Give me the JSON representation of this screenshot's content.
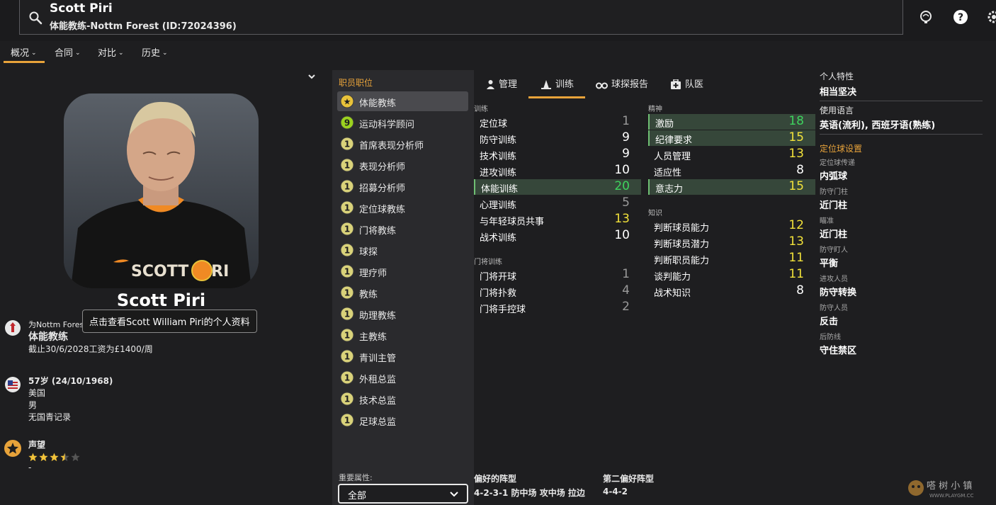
{
  "header": {
    "name": "Scott Piri",
    "subtitle": "体能教练-Nottm Forest (ID:72024396)"
  },
  "nav": [
    {
      "label": "概况"
    },
    {
      "label": "合同"
    },
    {
      "label": "对比"
    },
    {
      "label": "历史"
    }
  ],
  "profile": {
    "display_name": "Scott Piri",
    "tooltip": "点击查看Scott William Piri的个人资料",
    "club_line": "为Nottm Forest",
    "role": "体能教练",
    "contract": "截止30/6/2028工资为£1400/周",
    "age": "57岁 (24/10/1968)",
    "nationality": "美国",
    "gender": "男",
    "youth_record": "无国青记录",
    "reputation_label": "声望",
    "reputation_stars": 3.5,
    "reputation_value": "-"
  },
  "roles": {
    "title": "职员职位",
    "items": [
      {
        "label": "体能教练",
        "badge": "★",
        "badge_color": "#e8c23a",
        "active": true
      },
      {
        "label": "运动科学顾问",
        "badge": "9",
        "badge_color": "#9bd11f",
        "active": false
      },
      {
        "label": "首席表现分析师",
        "badge": "1",
        "badge_color": "#d9d27a",
        "active": false
      },
      {
        "label": "表现分析师",
        "badge": "1",
        "badge_color": "#d9d27a",
        "active": false
      },
      {
        "label": "招募分析师",
        "badge": "1",
        "badge_color": "#d9d27a",
        "active": false
      },
      {
        "label": "定位球教练",
        "badge": "1",
        "badge_color": "#d9d27a",
        "active": false
      },
      {
        "label": "门将教练",
        "badge": "1",
        "badge_color": "#d9d27a",
        "active": false
      },
      {
        "label": "球探",
        "badge": "1",
        "badge_color": "#d9d27a",
        "active": false
      },
      {
        "label": "理疗师",
        "badge": "1",
        "badge_color": "#d9d27a",
        "active": false
      },
      {
        "label": "教练",
        "badge": "1",
        "badge_color": "#d9d27a",
        "active": false
      },
      {
        "label": "助理教练",
        "badge": "1",
        "badge_color": "#d9d27a",
        "active": false
      },
      {
        "label": "主教练",
        "badge": "1",
        "badge_color": "#d9d27a",
        "active": false
      },
      {
        "label": "青训主管",
        "badge": "1",
        "badge_color": "#d9d27a",
        "active": false
      },
      {
        "label": "外租总监",
        "badge": "1",
        "badge_color": "#d9d27a",
        "active": false
      },
      {
        "label": "技术总监",
        "badge": "1",
        "badge_color": "#d9d27a",
        "active": false
      },
      {
        "label": "足球总监",
        "badge": "1",
        "badge_color": "#d9d27a",
        "active": false
      }
    ],
    "key_attr_label": "重要属性:",
    "key_attr_value": "全部"
  },
  "tabs": [
    {
      "label": "管理",
      "icon": "person-icon"
    },
    {
      "label": "训练",
      "icon": "cone-icon"
    },
    {
      "label": "球探报告",
      "icon": "binoculars-icon"
    },
    {
      "label": "队医",
      "icon": "medkit-icon"
    }
  ],
  "attributes": {
    "training_title": "训练",
    "training": [
      {
        "name": "定位球",
        "value": 1,
        "hl": false
      },
      {
        "name": "防守训练",
        "value": 9,
        "hl": false
      },
      {
        "name": "技术训练",
        "value": 9,
        "hl": false
      },
      {
        "name": "进攻训练",
        "value": 10,
        "hl": false
      },
      {
        "name": "体能训练",
        "value": 20,
        "hl": true
      },
      {
        "name": "心理训练",
        "value": 5,
        "hl": false
      },
      {
        "name": "与年轻球员共事",
        "value": 13,
        "hl": false
      },
      {
        "name": "战术训练",
        "value": 10,
        "hl": false
      }
    ],
    "gk_title": "门将训练",
    "gk": [
      {
        "name": "门将开球",
        "value": 1,
        "hl": false
      },
      {
        "name": "门将扑救",
        "value": 4,
        "hl": false
      },
      {
        "name": "门将手控球",
        "value": 2,
        "hl": false
      }
    ],
    "mental_title": "精神",
    "mental": [
      {
        "name": "激励",
        "value": 18,
        "hl": true
      },
      {
        "name": "纪律要求",
        "value": 15,
        "hl": true
      },
      {
        "name": "人员管理",
        "value": 13,
        "hl": false
      },
      {
        "name": "适应性",
        "value": 8,
        "hl": false
      },
      {
        "name": "意志力",
        "value": 15,
        "hl": true
      }
    ],
    "knowledge_title": "知识",
    "knowledge": [
      {
        "name": "判断球员能力",
        "value": 12,
        "hl": false
      },
      {
        "name": "判断球员潜力",
        "value": 13,
        "hl": false
      },
      {
        "name": "判断职员能力",
        "value": 11,
        "hl": false
      },
      {
        "name": "谈判能力",
        "value": 11,
        "hl": false
      },
      {
        "name": "战术知识",
        "value": 8,
        "hl": false
      }
    ]
  },
  "formations": {
    "preferred_label": "偏好的阵型",
    "preferred_value": "4-2-3-1 防中场 攻中场 拉边",
    "second_label": "第二偏好阵型",
    "second_value": "4-4-2"
  },
  "right": {
    "trait_label": "个人特性",
    "trait_value": "相当坚决",
    "lang_label": "使用语言",
    "lang_value": "英语(流利), 西班牙语(熟练)",
    "setpiece_title": "定位球设置",
    "setpieces": [
      {
        "label": "定位球传递",
        "value": "内弧球"
      },
      {
        "label": "防守门柱",
        "value": "近门柱"
      },
      {
        "label": "瞄准",
        "value": "近门柱"
      },
      {
        "label": "防守盯人",
        "value": "平衡"
      },
      {
        "label": "进攻人员",
        "value": "防守转换"
      },
      {
        "label": "防守人员",
        "value": "反击"
      },
      {
        "label": "后防线",
        "value": "守住禁区"
      }
    ]
  },
  "colors": {
    "accent": "#e8a33a",
    "val_green": "#3ed35e",
    "val_yellow": "#f2e23a",
    "val_grey": "#9a9a9a",
    "val_white": "#ffffff"
  }
}
